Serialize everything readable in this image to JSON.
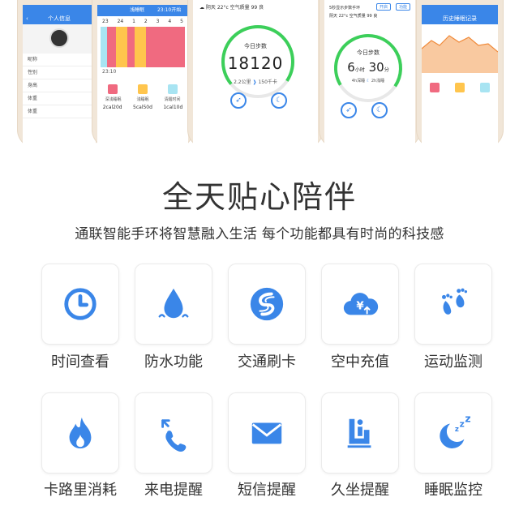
{
  "accent": "#3a86e8",
  "phones": {
    "p1": {
      "title": "个人信息",
      "rows": [
        "昵称",
        "性别",
        "身高",
        "体重",
        "体重"
      ]
    },
    "p2": {
      "header": "浅睡眠",
      "start": "23:10开始",
      "ticks": [
        "23",
        "24",
        "1",
        "2",
        "3",
        "4",
        "5"
      ],
      "end": "23:10",
      "icons": [
        "深浅睡眠",
        "浅睡眠",
        "清醒时间"
      ],
      "vals": [
        "2cal20d",
        "5cal50d",
        "1cal10d"
      ],
      "colors": [
        "#f06a80",
        "#ffc54d",
        "#a8e4f2"
      ]
    },
    "p3": {
      "weather": "阴天 22°c 空气质量 99 良",
      "title": "今日步数",
      "steps": "18120",
      "dist": "2.2公里",
      "kcal": "150千卡"
    },
    "p4": {
      "weather": "阴天 22°c 空气质量 99 良",
      "header": "5秒显示步数手环",
      "btn1": "开启",
      "btn2": "功能",
      "title": "今日步数",
      "hours": "6",
      "hours_unit": "小时",
      "minutes": "30",
      "minutes_unit": "分",
      "deep": "4h深睡",
      "light": "2h浅睡"
    },
    "p5": {
      "title": "历史睡眠记录"
    }
  },
  "headline": "全天贴心陪伴",
  "subheadline": "通联智能手环将智慧融入生活 每个功能都具有时尚的科技感",
  "features": [
    {
      "label": "时间查看",
      "icon": "clock-icon"
    },
    {
      "label": "防水功能",
      "icon": "water-drop-icon"
    },
    {
      "label": "交通刷卡",
      "icon": "transit-card-icon"
    },
    {
      "label": "空中充值",
      "icon": "cloud-recharge-icon"
    },
    {
      "label": "运动监测",
      "icon": "footprints-icon"
    },
    {
      "label": "卡路里消耗",
      "icon": "flame-icon"
    },
    {
      "label": "来电提醒",
      "icon": "incoming-call-icon"
    },
    {
      "label": "短信提醒",
      "icon": "envelope-icon"
    },
    {
      "label": "久坐提醒",
      "icon": "sitting-icon"
    },
    {
      "label": "睡眠监控",
      "icon": "sleep-moon-icon"
    }
  ]
}
